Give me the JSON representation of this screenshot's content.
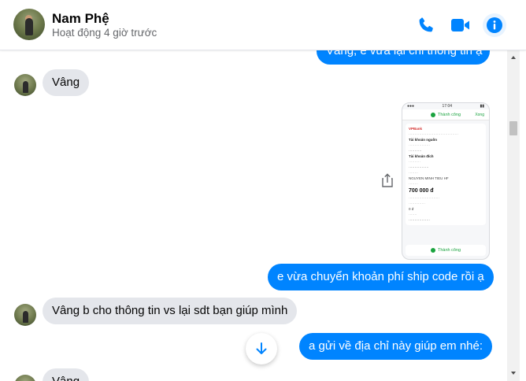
{
  "header": {
    "name": "Nam Phệ",
    "status": "Hoạt động 4 giờ trước"
  },
  "messages": {
    "m0_partial": "Vâng, e vừa lại chi thông tin ạ",
    "m1": "Vâng",
    "m3": "e vừa chuyển khoản phí ship code rồi ạ",
    "m4": "Vâng b cho thông tin vs lại sdt bạn giúp mình",
    "m5": "a gửi về địa chỉ này giúp em nhé:",
    "m6_partial": "Vâng"
  },
  "receipt": {
    "status": "Thành công",
    "done_label": "Xong",
    "bank": "VPBank",
    "source_label": "Tài khoản nguồn",
    "dest_label": "Tài khoản đích",
    "amount": "700 000",
    "currency": "đ",
    "fee": "0 đ",
    "footer_status": "Thành công",
    "receiver": "NGUYEN MINH TIEU HF"
  },
  "icons": {
    "phone": "phone-icon",
    "video": "video-camera-icon",
    "info": "info-icon",
    "share": "share-icon",
    "scroll_down": "arrow-down-icon"
  },
  "colors": {
    "accent": "#0084ff",
    "incoming_bubble": "#e4e6eb",
    "success": "#1aa33f"
  }
}
